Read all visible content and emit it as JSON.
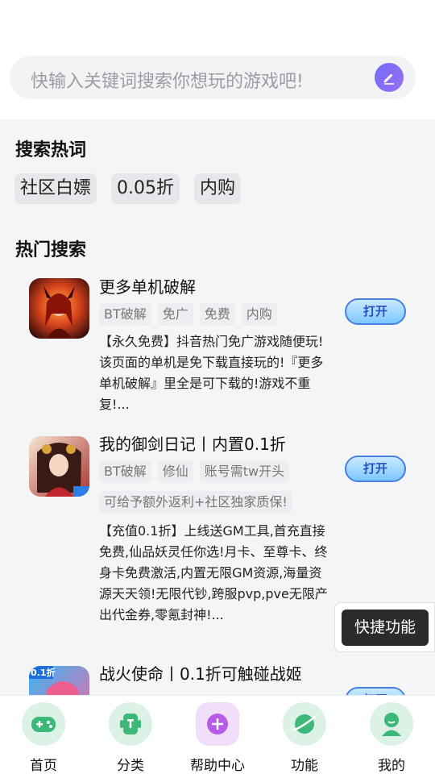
{
  "search": {
    "placeholder": "快输入关键词搜索你想玩的游戏吧!"
  },
  "hot_words": {
    "title": "搜索热词",
    "tags": [
      "社区白嫖",
      "0.05折",
      "内购"
    ]
  },
  "hot_search": {
    "title": "热门搜索",
    "open_label": "打开",
    "games": [
      {
        "name": "更多单机破解",
        "tags": [
          "BT破解",
          "免广",
          "免费",
          "内购"
        ],
        "desc": "【永久免费】抖音热门免广游戏随便玩!该页面的单机是免下载直接玩的!『更多单机破解』里全是可下载的!游戏不重复!..."
      },
      {
        "name": "我的御剑日记丨内置0.1折",
        "tags": [
          "BT破解",
          "修仙",
          "账号需tw开头"
        ],
        "note": "可给予额外返利+社区独家质保!",
        "desc": "【充值0.1折】上线送GM工具,首充直接免费,仙品妖灵任你选!月卡、至尊卡、终身卡免费激活,内置无限GM资源,海量资源天天领!无限代钞,跨服pvp,pve无限产出代金券,零氪封神!..."
      },
      {
        "name": "战火使命丨0.1折可触碰战姬",
        "badge": "0.1折"
      }
    ]
  },
  "quick_action": "快捷功能",
  "tabs": [
    {
      "label": "首页"
    },
    {
      "label": "分类"
    },
    {
      "label": "帮助中心"
    },
    {
      "label": "功能"
    },
    {
      "label": "我的"
    }
  ],
  "colors": {
    "accent": "#7a6cf5",
    "tab_green": "#3cb878",
    "tab_bg": "#dcf2e6",
    "help_purple": "#b65ce8"
  }
}
